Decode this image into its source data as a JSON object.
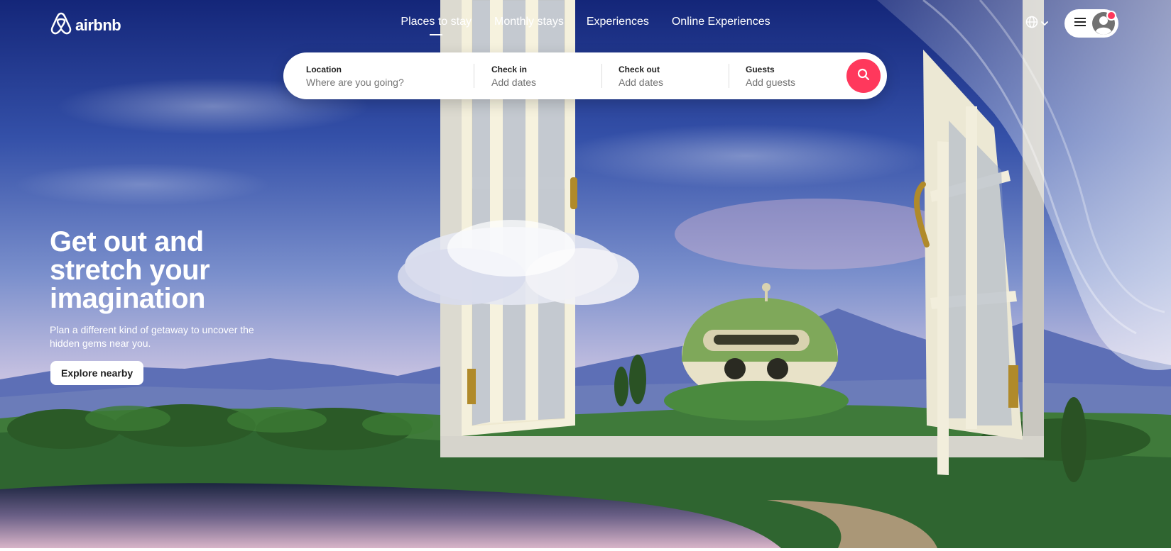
{
  "header": {
    "logo_text": "airbnb",
    "nav": [
      {
        "label": "Places to stay",
        "active": true
      },
      {
        "label": "Monthly stays",
        "active": false
      },
      {
        "label": "Experiences",
        "active": false
      },
      {
        "label": "Online Experiences",
        "active": false
      }
    ],
    "icons": {
      "logo": "airbnb-logo-icon",
      "globe": "globe-icon",
      "chevron": "chevron-down-icon",
      "menu": "hamburger-menu-icon",
      "avatar": "user-avatar-icon"
    }
  },
  "search": {
    "location": {
      "label": "Location",
      "placeholder": "Where are you going?"
    },
    "check_in": {
      "label": "Check in",
      "placeholder": "Add dates"
    },
    "check_out": {
      "label": "Check out",
      "placeholder": "Add dates"
    },
    "guests": {
      "label": "Guests",
      "placeholder": "Add guests"
    },
    "button_icon": "search-icon"
  },
  "hero": {
    "headline": "Get out and stretch your imagination",
    "subtext": "Plan a different kind of getaway to uncover the hidden gems near you.",
    "cta": "Explore nearby"
  },
  "colors": {
    "brand": "#ff385c",
    "sky_top": "#1a2a80",
    "text_dark": "#222222",
    "text_muted": "#717171"
  }
}
